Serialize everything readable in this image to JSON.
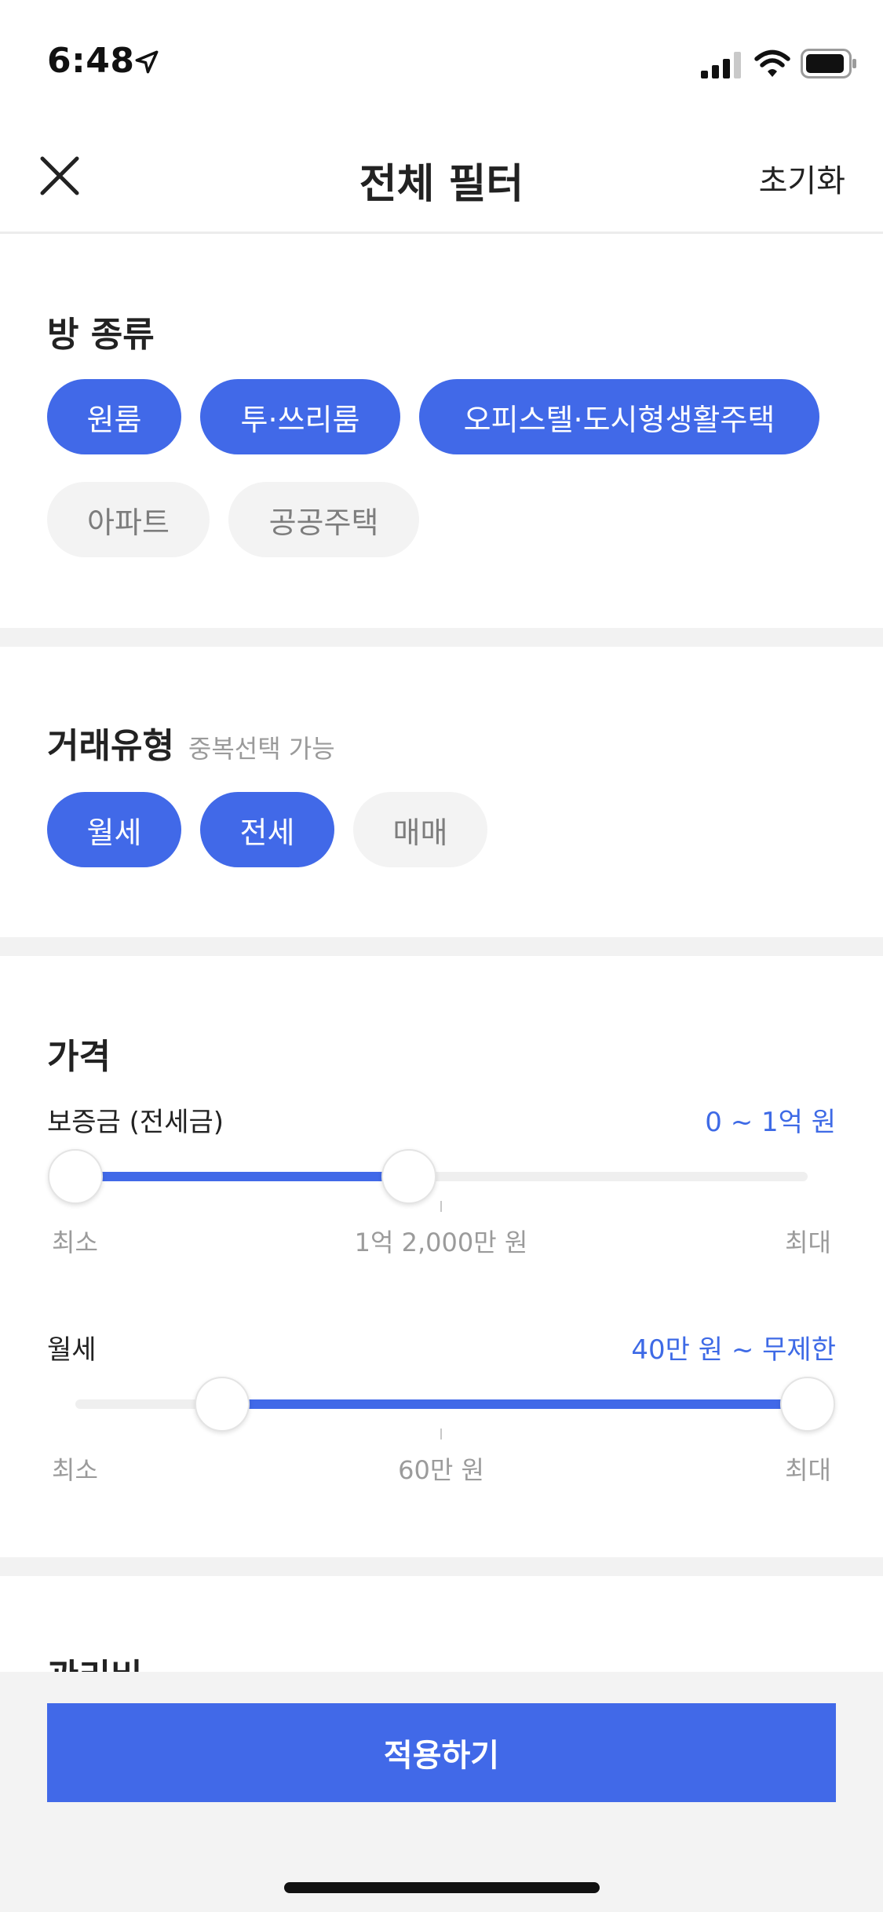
{
  "status": {
    "time": "6:48"
  },
  "nav": {
    "title": "전체 필터",
    "reset": "초기화"
  },
  "room_type": {
    "title": "방 종류",
    "chips": [
      {
        "label": "원룸",
        "selected": true
      },
      {
        "label": "투·쓰리룸",
        "selected": true
      },
      {
        "label": "오피스텔·도시형생활주택",
        "selected": true
      },
      {
        "label": "아파트",
        "selected": false
      },
      {
        "label": "공공주택",
        "selected": false
      }
    ]
  },
  "deal_type": {
    "title": "거래유형",
    "subtitle": "중복선택 가능",
    "chips": [
      {
        "label": "월세",
        "selected": true
      },
      {
        "label": "전세",
        "selected": true
      },
      {
        "label": "매매",
        "selected": false
      }
    ]
  },
  "price": {
    "title": "가격",
    "deposit": {
      "label": "보증금 (전세금)",
      "range_text": "0 ~ 1억 원",
      "min_label": "최소",
      "mid_label": "1억 2,000만 원",
      "max_label": "최대",
      "low_fraction": 0.0,
      "high_fraction": 0.455
    },
    "monthly": {
      "label": "월세",
      "range_text": "40만 원 ~ 무제한",
      "min_label": "최소",
      "mid_label": "60만 원",
      "max_label": "최대",
      "low_fraction": 0.2,
      "high_fraction": 1.0
    }
  },
  "maintenance": {
    "title": "관리비"
  },
  "apply": {
    "label": "적용하기"
  },
  "colors": {
    "accent": "#4169e8",
    "chip_off": "#f3f3f3",
    "divider": "#f2f2f2"
  },
  "icons": [
    "location-arrow-icon",
    "signal-icon",
    "wifi-icon",
    "battery-icon",
    "close-icon"
  ]
}
